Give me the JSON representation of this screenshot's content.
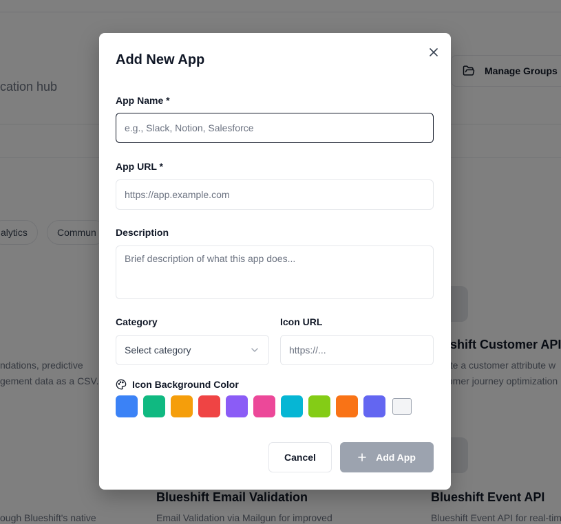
{
  "background": {
    "hub_text": "cation hub",
    "manage_groups_label": "Manage Groups",
    "chips": [
      "alytics",
      "Commun"
    ],
    "cards": [
      {
        "title": "eshift Customer API",
        "desc_lines": [
          "ate a customer attribute w",
          "tomer journey optimization"
        ]
      },
      {
        "title": "Blueshift Email Validation",
        "desc_lines": [
          "Email Validation via Mailgun for improved"
        ]
      },
      {
        "title": "Blueshift Event API",
        "desc_lines": [
          "Blueshift Event API for real-tim"
        ]
      }
    ],
    "left_desc_lines": [
      "ndations, predictive",
      "gement data as a CSV..."
    ],
    "bottom_left_desc": "ough Blueshift's native"
  },
  "modal": {
    "title": "Add New App",
    "app_name": {
      "label": "App Name *",
      "placeholder": "e.g., Slack, Notion, Salesforce",
      "value": ""
    },
    "app_url": {
      "label": "App URL *",
      "placeholder": "https://app.example.com",
      "value": ""
    },
    "description": {
      "label": "Description",
      "placeholder": "Brief description of what this app does...",
      "value": ""
    },
    "category": {
      "label": "Category",
      "selected": "Select category"
    },
    "icon_url": {
      "label": "Icon URL",
      "placeholder": "https://...",
      "value": ""
    },
    "icon_color": {
      "label": "Icon Background Color",
      "swatches": [
        "#3b82f6",
        "#10b981",
        "#f59e0b",
        "#ef4444",
        "#8b5cf6",
        "#ec4899",
        "#06b6d4",
        "#84cc16",
        "#f97316",
        "#6366f1",
        "#f3f4f6"
      ]
    },
    "cancel_label": "Cancel",
    "add_label": "Add App"
  }
}
